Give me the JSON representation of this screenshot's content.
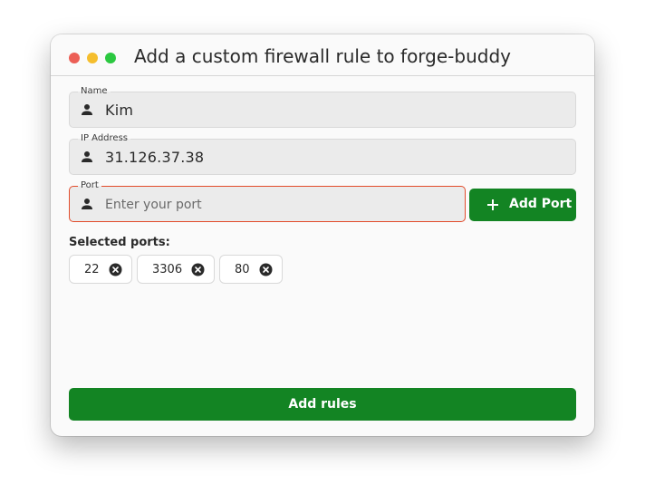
{
  "window": {
    "title": "Add a custom firewall rule to forge-buddy"
  },
  "form": {
    "name": {
      "label": "Name",
      "value": "Kim",
      "icon": "person-icon"
    },
    "ip": {
      "label": "IP Address",
      "value": "31.126.37.38",
      "icon": "person-icon"
    },
    "port": {
      "label": "Port",
      "value": "",
      "placeholder": "Enter your port",
      "icon": "person-icon",
      "state": "error"
    }
  },
  "add_port_button": {
    "label": "Add Port",
    "icon": "plus-icon"
  },
  "selected_ports": {
    "label": "Selected ports:",
    "items": [
      {
        "value": "22"
      },
      {
        "value": "3306"
      },
      {
        "value": "80"
      }
    ]
  },
  "add_rules_button": {
    "label": "Add rules"
  },
  "colors": {
    "accent": "#138423",
    "error_border": "#e24b2a",
    "close": "#ec5f56",
    "minimize": "#f5be2e",
    "maximize": "#2bc840"
  }
}
